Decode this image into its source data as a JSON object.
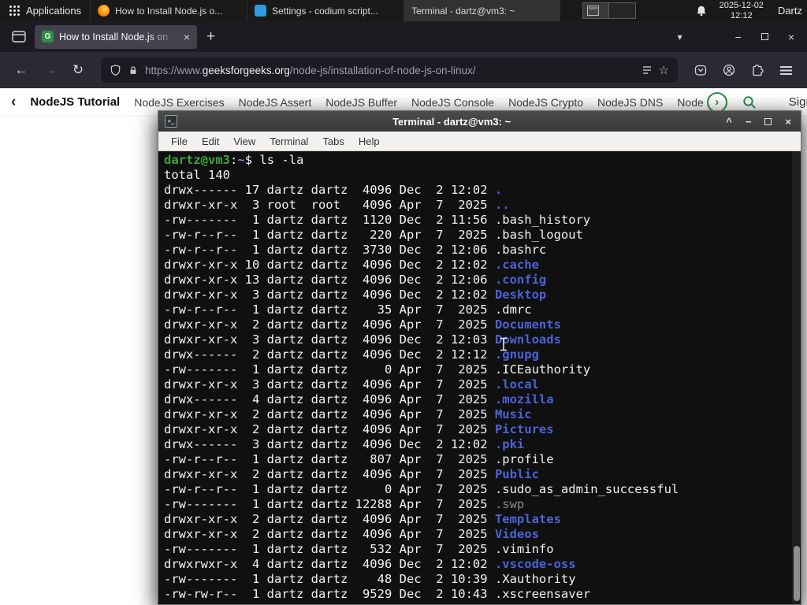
{
  "colors": {
    "accent_green": "#2f8d46",
    "dir_blue": "#4a63d8",
    "prompt_green": "#3fa33f",
    "cwd_blue": "#6f8fdb",
    "dim_gray": "#8a8a8a",
    "term_fg": "#f1f1f1",
    "term_bg": "#101010"
  },
  "panel": {
    "applications_label": "Applications",
    "tasks": [
      {
        "label": "How to Install Node.js o...",
        "icon": "firefox-icon"
      },
      {
        "label": "Settings - codium script...",
        "icon": "codium-icon"
      },
      {
        "label": "Terminal - dartz@vm3: ~",
        "icon": "terminal-icon"
      }
    ],
    "date": "2025-12-02",
    "time": "12:12",
    "user": "Dartz"
  },
  "browser": {
    "tab_title": "How to Install Node.js on",
    "tab_favicon": "G",
    "glyphs": {
      "back": "←",
      "forward": "→",
      "reload": "↻",
      "new_tab": "+",
      "tab_close": "×",
      "tabs_chevron": "▾",
      "minimize": "−",
      "close": "×",
      "star": "☆"
    },
    "url_prefix": "https://www.",
    "url_domain": "geeksforgeeks.org",
    "url_path": "/node-js/installation-of-node-js-on-linux/",
    "site_nav": {
      "chevron_left": "‹",
      "chevron_right": "›",
      "primary": "NodeJS Tutorial",
      "items": [
        "NodeJS Exercises",
        "NodeJS Assert",
        "NodeJS Buffer",
        "NodeJS Console",
        "NodeJS Crypto",
        "NodeJS DNS",
        "Node"
      ],
      "sign_in": "Sign In"
    }
  },
  "terminal": {
    "title": "Terminal - dartz@vm3: ~",
    "menus": [
      "File",
      "Edit",
      "View",
      "Terminal",
      "Tabs",
      "Help"
    ],
    "controls": {
      "rollup": "^",
      "minimize": "−",
      "close": "×"
    },
    "prompt_user_host": "dartz@vm3",
    "prompt_sep": ":",
    "prompt_cwd": "~",
    "prompt_dollar": "$ ",
    "prompt_command": "ls -la",
    "total_line": "total 140",
    "listing": [
      {
        "pre": "drwx------ 17 dartz dartz  4096 Dec  2 12:02 ",
        "name": ".",
        "type": "dir"
      },
      {
        "pre": "drwxr-xr-x  3 root  root   4096 Apr  7  2025 ",
        "name": "..",
        "type": "dir"
      },
      {
        "pre": "-rw-------  1 dartz dartz  1120 Dec  2 11:56 ",
        "name": ".bash_history",
        "type": "file"
      },
      {
        "pre": "-rw-r--r--  1 dartz dartz   220 Apr  7  2025 ",
        "name": ".bash_logout",
        "type": "file"
      },
      {
        "pre": "-rw-r--r--  1 dartz dartz  3730 Dec  2 12:06 ",
        "name": ".bashrc",
        "type": "file"
      },
      {
        "pre": "drwxr-xr-x 10 dartz dartz  4096 Dec  2 12:02 ",
        "name": ".cache",
        "type": "dir"
      },
      {
        "pre": "drwxr-xr-x 13 dartz dartz  4096 Dec  2 12:06 ",
        "name": ".config",
        "type": "dir"
      },
      {
        "pre": "drwxr-xr-x  3 dartz dartz  4096 Dec  2 12:02 ",
        "name": "Desktop",
        "type": "dir"
      },
      {
        "pre": "-rw-r--r--  1 dartz dartz    35 Apr  7  2025 ",
        "name": ".dmrc",
        "type": "file"
      },
      {
        "pre": "drwxr-xr-x  2 dartz dartz  4096 Apr  7  2025 ",
        "name": "Documents",
        "type": "dir"
      },
      {
        "pre": "drwxr-xr-x  3 dartz dartz  4096 Dec  2 12:03 ",
        "name": "Downloads",
        "type": "dir"
      },
      {
        "pre": "drwx------  2 dartz dartz  4096 Dec  2 12:12 ",
        "name": ".gnupg",
        "type": "dir"
      },
      {
        "pre": "-rw-------  1 dartz dartz     0 Apr  7  2025 ",
        "name": ".ICEauthority",
        "type": "file"
      },
      {
        "pre": "drwxr-xr-x  3 dartz dartz  4096 Apr  7  2025 ",
        "name": ".local",
        "type": "dir"
      },
      {
        "pre": "drwx------  4 dartz dartz  4096 Apr  7  2025 ",
        "name": ".mozilla",
        "type": "dir"
      },
      {
        "pre": "drwxr-xr-x  2 dartz dartz  4096 Apr  7  2025 ",
        "name": "Music",
        "type": "dir"
      },
      {
        "pre": "drwxr-xr-x  2 dartz dartz  4096 Apr  7  2025 ",
        "name": "Pictures",
        "type": "dir"
      },
      {
        "pre": "drwx------  3 dartz dartz  4096 Dec  2 12:02 ",
        "name": ".pki",
        "type": "dir"
      },
      {
        "pre": "-rw-r--r--  1 dartz dartz   807 Apr  7  2025 ",
        "name": ".profile",
        "type": "file"
      },
      {
        "pre": "drwxr-xr-x  2 dartz dartz  4096 Apr  7  2025 ",
        "name": "Public",
        "type": "dir"
      },
      {
        "pre": "-rw-r--r--  1 dartz dartz     0 Apr  7  2025 ",
        "name": ".sudo_as_admin_successful",
        "type": "file"
      },
      {
        "pre": "-rw-------  1 dartz dartz 12288 Apr  7  2025 ",
        "name": ".swp",
        "type": "dim"
      },
      {
        "pre": "drwxr-xr-x  2 dartz dartz  4096 Apr  7  2025 ",
        "name": "Templates",
        "type": "dir"
      },
      {
        "pre": "drwxr-xr-x  2 dartz dartz  4096 Apr  7  2025 ",
        "name": "Videos",
        "type": "dir"
      },
      {
        "pre": "-rw-------  1 dartz dartz   532 Apr  7  2025 ",
        "name": ".viminfo",
        "type": "file"
      },
      {
        "pre": "drwxrwxr-x  4 dartz dartz  4096 Dec  2 12:02 ",
        "name": ".vscode-oss",
        "type": "dir"
      },
      {
        "pre": "-rw-------  1 dartz dartz    48 Dec  2 10:39 ",
        "name": ".Xauthority",
        "type": "file"
      },
      {
        "pre": "-rw-rw-r--  1 dartz dartz  9529 Dec  2 10:43 ",
        "name": ".xscreensaver",
        "type": "file"
      }
    ]
  }
}
